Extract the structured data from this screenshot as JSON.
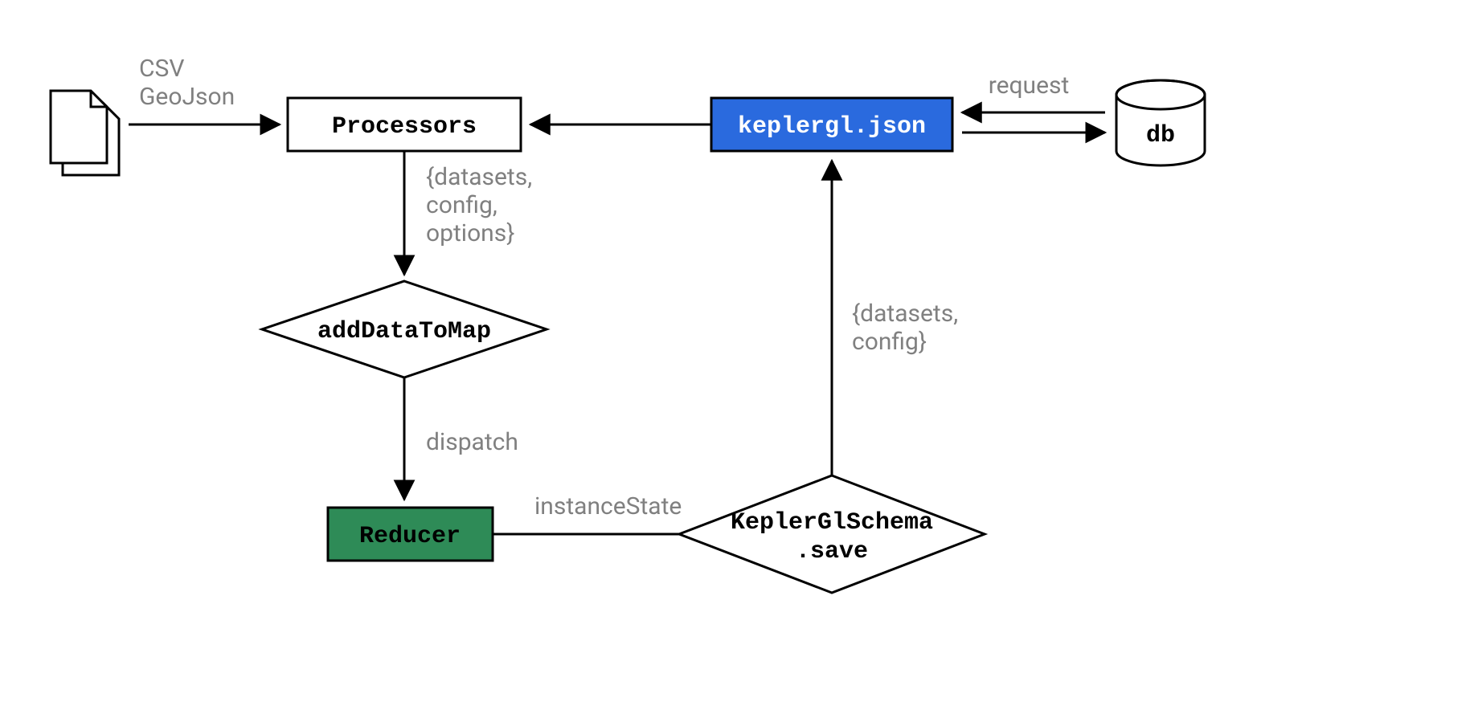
{
  "colors": {
    "stroke": "#000000",
    "muted": "#808080",
    "blue": "#2A6ADE",
    "green": "#2E8B57",
    "white": "#ffffff"
  },
  "nodes": {
    "files_label_1": "CSV",
    "files_label_2": "GeoJson",
    "processors": "Processors",
    "keplergl_json": "keplergl.json",
    "db": "db",
    "addDataToMap": "addDataToMap",
    "reducer": "Reducer",
    "schema_line1": "KeplerGlSchema",
    "schema_line2": ".save"
  },
  "edges": {
    "request": "request",
    "payload1_l1": "{datasets,",
    "payload1_l2": "config,",
    "payload1_l3": "options}",
    "dispatch": "dispatch",
    "instanceState": "instanceState",
    "payload2_l1": "{datasets,",
    "payload2_l2": "config}"
  }
}
